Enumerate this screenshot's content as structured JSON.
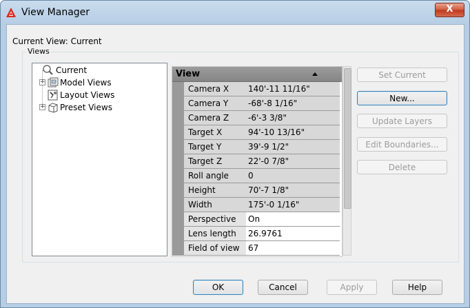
{
  "window": {
    "title": "View Manager",
    "close_label": "X"
  },
  "current_view_text": "Current View: Current",
  "views_group_label": "Views",
  "tree": {
    "items": [
      {
        "label": "Current",
        "icon": "camera-view-icon"
      },
      {
        "label": "Model Views",
        "icon": "model-views-icon"
      },
      {
        "label": "Layout Views",
        "icon": "layout-views-icon"
      },
      {
        "label": "Preset Views",
        "icon": "preset-views-icon"
      }
    ]
  },
  "properties": {
    "header": "View",
    "rows": [
      {
        "name": "Camera X",
        "value": "140'-11 11/16\""
      },
      {
        "name": "Camera Y",
        "value": "-68'-8 1/16\""
      },
      {
        "name": "Camera Z",
        "value": "-6'-3 3/8\""
      },
      {
        "name": "Target X",
        "value": "94'-10 13/16\""
      },
      {
        "name": "Target Y",
        "value": "39'-9 1/2\""
      },
      {
        "name": "Target Z",
        "value": "22'-0 7/8\""
      },
      {
        "name": "Roll angle",
        "value": "0"
      },
      {
        "name": "Height",
        "value": "70'-7 1/8\""
      },
      {
        "name": "Width",
        "value": "175'-0 1/16\""
      },
      {
        "name": "Perspective",
        "value": "On"
      },
      {
        "name": "Lens length (...",
        "value": "26.9761"
      },
      {
        "name": "Field of view",
        "value": "67"
      }
    ]
  },
  "side_buttons": {
    "set_current": "Set Current",
    "new": "New...",
    "update_layers": "Update Layers",
    "edit_boundaries": "Edit Boundaries...",
    "delete": "Delete"
  },
  "footer_buttons": {
    "ok": "OK",
    "cancel": "Cancel",
    "apply": "Apply",
    "help": "Help"
  },
  "colors": {
    "title_gradient": "#c9dcee",
    "close_red": "#c0371c",
    "header_gray": "#858585",
    "cell_gray": "#d8d8d8"
  }
}
